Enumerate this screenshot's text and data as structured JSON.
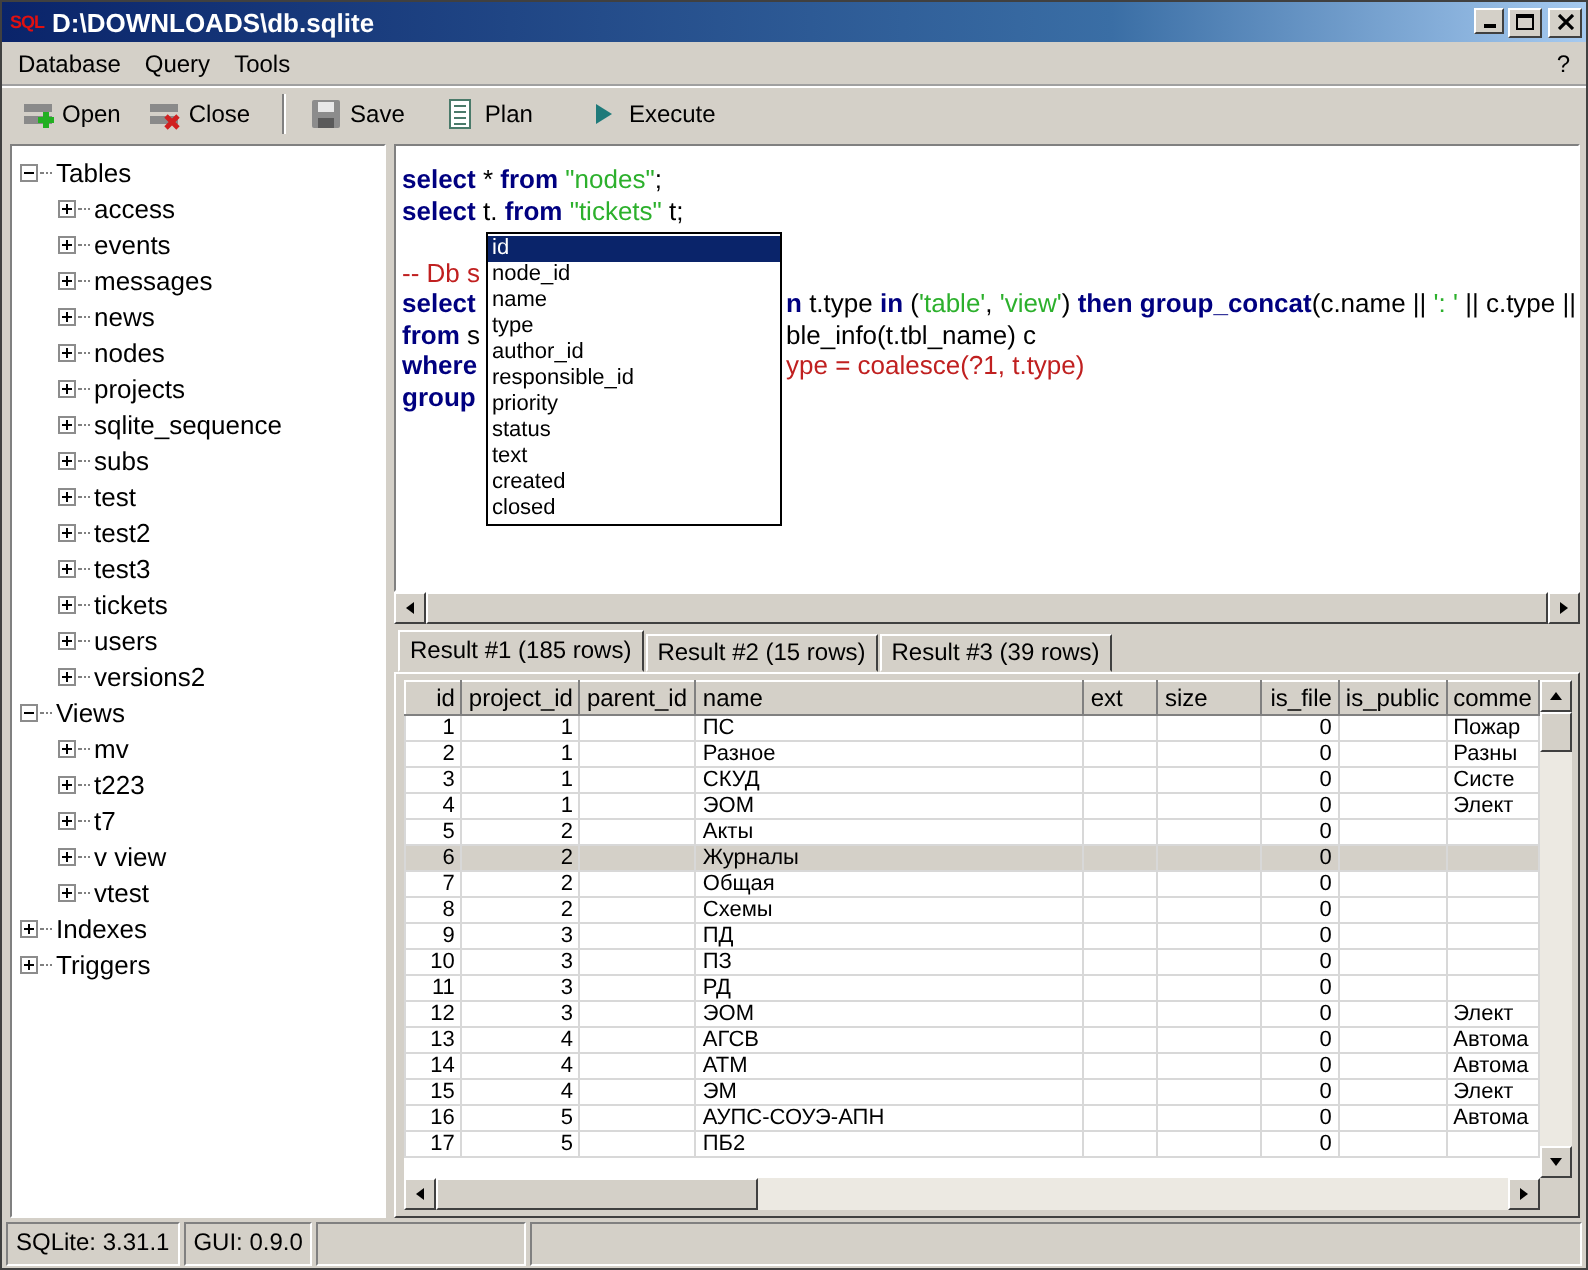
{
  "window": {
    "logo": "SQL",
    "title": "D:\\DOWNLOADS\\db.sqlite"
  },
  "menu": [
    "Database",
    "Query",
    "Tools"
  ],
  "help_menu": "?",
  "toolbar": [
    {
      "kind": "open",
      "label": "Open"
    },
    {
      "kind": "close",
      "label": "Close"
    },
    {
      "kind": "separator"
    },
    {
      "kind": "save",
      "label": "Save"
    },
    {
      "kind": "plan",
      "label": "Plan"
    },
    {
      "kind": "execute",
      "label": "Execute"
    }
  ],
  "tree": [
    {
      "label": "Tables",
      "expanded": true,
      "children": [
        {
          "label": "access",
          "expanded": false
        },
        {
          "label": "events",
          "expanded": false
        },
        {
          "label": "messages",
          "expanded": false
        },
        {
          "label": "news",
          "expanded": false
        },
        {
          "label": "nodes",
          "expanded": false
        },
        {
          "label": "projects",
          "expanded": false
        },
        {
          "label": "sqlite_sequence",
          "expanded": false
        },
        {
          "label": "subs",
          "expanded": false
        },
        {
          "label": "test",
          "expanded": false
        },
        {
          "label": "test2",
          "expanded": false
        },
        {
          "label": "test3",
          "expanded": false
        },
        {
          "label": "tickets",
          "expanded": false
        },
        {
          "label": "users",
          "expanded": false
        },
        {
          "label": "versions2",
          "expanded": false
        }
      ]
    },
    {
      "label": "Views",
      "expanded": true,
      "children": [
        {
          "label": "mv",
          "expanded": false
        },
        {
          "label": "t223",
          "expanded": false
        },
        {
          "label": "t7",
          "expanded": false
        },
        {
          "label": "v view",
          "expanded": false
        },
        {
          "label": "vtest",
          "expanded": false
        }
      ]
    },
    {
      "label": "Indexes",
      "expanded": false
    },
    {
      "label": "Triggers",
      "expanded": false
    }
  ],
  "editor": {
    "lines": [
      {
        "kind": "code",
        "left": [
          {
            "kind": "keyword",
            "text": "select"
          },
          {
            "kind": "plain",
            "text": " * "
          },
          {
            "kind": "keyword",
            "text": "from"
          },
          {
            "kind": "string",
            "text": " \"nodes\""
          },
          {
            "kind": "plain",
            "text": ";"
          }
        ]
      },
      {
        "kind": "code",
        "left": [
          {
            "kind": "keyword",
            "text": "select"
          },
          {
            "kind": "plain",
            "text": " t. "
          },
          {
            "kind": "keyword",
            "text": "from"
          },
          {
            "kind": "string",
            "text": " \"tickets\""
          },
          {
            "kind": "plain",
            "text": " t;"
          }
        ]
      },
      {
        "kind": "blank"
      },
      {
        "kind": "code",
        "left": [
          {
            "kind": "comment",
            "text": "-- Db s"
          }
        ]
      },
      {
        "kind": "code",
        "left": [
          {
            "kind": "keyword",
            "text": "select"
          }
        ],
        "right": [
          {
            "kind": "keyword",
            "text": "n"
          },
          {
            "kind": "plain",
            "text": " t.type "
          },
          {
            "kind": "keyword",
            "text": "in"
          },
          {
            "kind": "plain",
            "text": " ("
          },
          {
            "kind": "string",
            "text": "'table'"
          },
          {
            "kind": "plain",
            "text": ", "
          },
          {
            "kind": "string",
            "text": "'view'"
          },
          {
            "kind": "plain",
            "text": ") "
          },
          {
            "kind": "keyword",
            "text": "then"
          },
          {
            "kind": "keyword",
            "text": " group_concat"
          },
          {
            "kind": "plain",
            "text": "(c.name || "
          },
          {
            "kind": "string",
            "text": "': '"
          },
          {
            "kind": "plain",
            "text": " || c.type ||"
          }
        ]
      },
      {
        "kind": "code",
        "left": [
          {
            "kind": "keyword",
            "text": "from"
          },
          {
            "kind": "plain",
            "text": " s"
          }
        ],
        "right": [
          {
            "kind": "plain",
            "text": "ble_info(t.tbl_name) c"
          }
        ]
      },
      {
        "kind": "code",
        "left": [
          {
            "kind": "keyword",
            "text": "where"
          }
        ],
        "right": [
          {
            "kind": "comment",
            "text": "ype = coalesce(?1, t.type)"
          }
        ]
      },
      {
        "kind": "code",
        "left": [
          {
            "kind": "keyword",
            "text": "group"
          }
        ]
      }
    ],
    "completion": [
      {
        "text": "id",
        "selected": true
      },
      {
        "text": "node_id",
        "selected": false
      },
      {
        "text": "name",
        "selected": false
      },
      {
        "text": "type",
        "selected": false
      },
      {
        "text": "author_id",
        "selected": false
      },
      {
        "text": "responsible_id",
        "selected": false
      },
      {
        "text": "priority",
        "selected": false
      },
      {
        "text": "status",
        "selected": false
      },
      {
        "text": "text",
        "selected": false
      },
      {
        "text": "created",
        "selected": false
      },
      {
        "text": "closed",
        "selected": false
      }
    ]
  },
  "result_tabs": [
    {
      "label": "Result #1 (185 rows)",
      "selected": true
    },
    {
      "label": "Result #2 (15 rows)",
      "selected": false
    },
    {
      "label": "Result #3 (39 rows)",
      "selected": false
    }
  ],
  "table": {
    "columns": [
      "id",
      "project_id",
      "parent_id",
      "name",
      "ext",
      "size",
      "is_file",
      "is_public",
      "comme"
    ],
    "rows": [
      {
        "selected": false,
        "cells": [
          "1",
          "1",
          null,
          "ПС",
          null,
          null,
          "0",
          null,
          "Пожар"
        ]
      },
      {
        "selected": false,
        "cells": [
          "2",
          "1",
          null,
          "Разное",
          null,
          null,
          "0",
          null,
          "Разны"
        ]
      },
      {
        "selected": false,
        "cells": [
          "3",
          "1",
          null,
          "СКУД",
          null,
          null,
          "0",
          null,
          "Систе"
        ]
      },
      {
        "selected": false,
        "cells": [
          "4",
          "1",
          null,
          "ЭОМ",
          null,
          null,
          "0",
          null,
          "Элект"
        ]
      },
      {
        "selected": false,
        "cells": [
          "5",
          "2",
          null,
          "Акты",
          null,
          null,
          "0",
          null,
          null
        ]
      },
      {
        "selected": true,
        "cells": [
          "6",
          "2",
          null,
          "Журналы",
          null,
          null,
          "0",
          null,
          null
        ]
      },
      {
        "selected": false,
        "cells": [
          "7",
          "2",
          null,
          "Общая",
          null,
          null,
          "0",
          null,
          null
        ]
      },
      {
        "selected": false,
        "cells": [
          "8",
          "2",
          null,
          "Схемы",
          null,
          null,
          "0",
          null,
          null
        ]
      },
      {
        "selected": false,
        "cells": [
          "9",
          "3",
          null,
          "ПД",
          null,
          null,
          "0",
          null,
          null
        ]
      },
      {
        "selected": false,
        "cells": [
          "10",
          "3",
          null,
          "ПЗ",
          null,
          null,
          "0",
          null,
          null
        ]
      },
      {
        "selected": false,
        "cells": [
          "11",
          "3",
          null,
          "РД",
          null,
          null,
          "0",
          null,
          null
        ]
      },
      {
        "selected": false,
        "cells": [
          "12",
          "3",
          null,
          "ЭОМ",
          null,
          null,
          "0",
          null,
          "Элект"
        ]
      },
      {
        "selected": false,
        "cells": [
          "13",
          "4",
          null,
          "АГСВ",
          null,
          null,
          "0",
          null,
          "Автома"
        ]
      },
      {
        "selected": false,
        "cells": [
          "14",
          "4",
          null,
          "АТМ",
          null,
          null,
          "0",
          null,
          "Автома"
        ]
      },
      {
        "selected": false,
        "cells": [
          "15",
          "4",
          null,
          "ЭМ",
          null,
          null,
          "0",
          null,
          "Элект"
        ]
      },
      {
        "selected": false,
        "cells": [
          "16",
          "5",
          null,
          "АУПС-СОУЭ-АПН",
          null,
          null,
          "0",
          null,
          "Автома"
        ]
      },
      {
        "selected": false,
        "cells": [
          "17",
          "5",
          null,
          "ПБ2",
          null,
          null,
          "0",
          null,
          null
        ]
      }
    ]
  },
  "status_bar": [
    "SQLite: 3.31.1",
    "GUI: 0.9.0"
  ]
}
